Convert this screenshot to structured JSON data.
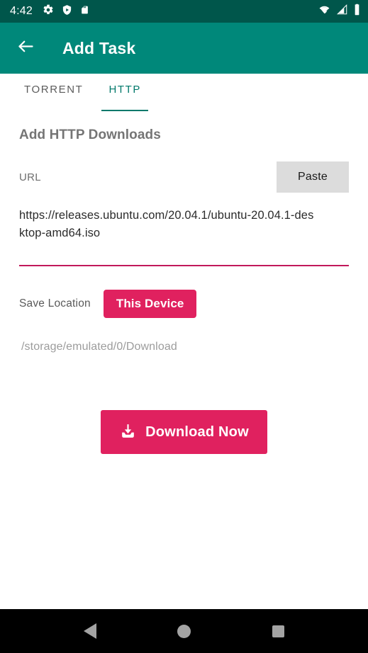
{
  "status_bar": {
    "time": "4:42",
    "left_icons": [
      "gear-icon",
      "shield-play-icon",
      "sd-card-icon"
    ],
    "right_icons": [
      "wifi-icon",
      "cell-signal-icon",
      "battery-icon"
    ],
    "background_color": "#00564B"
  },
  "app_bar": {
    "back_icon": "back-arrow-icon",
    "title": "Add Task",
    "background_color": "#00887A"
  },
  "tabs": [
    {
      "label": "TORRENT",
      "active": false
    },
    {
      "label": "HTTP",
      "active": true
    }
  ],
  "main": {
    "section_title": "Add HTTP Downloads",
    "url": {
      "label": "URL",
      "paste_label": "Paste",
      "value": "https://releases.ubuntu.com/20.04.1/ubuntu-20.04.1-desktop-amd64.iso",
      "placeholder": "URL",
      "underline_color": "#C2185B"
    },
    "save_location": {
      "label": "Save Location",
      "button_label": "This Device",
      "path": "/storage/emulated/0/Download",
      "accent_color": "#E0215F"
    },
    "download_button": {
      "label": "Download Now",
      "icon": "download-icon",
      "color": "#E0215F"
    }
  },
  "nav_bar": {
    "back_label": "Back",
    "home_label": "Home",
    "recents_label": "Recents"
  }
}
